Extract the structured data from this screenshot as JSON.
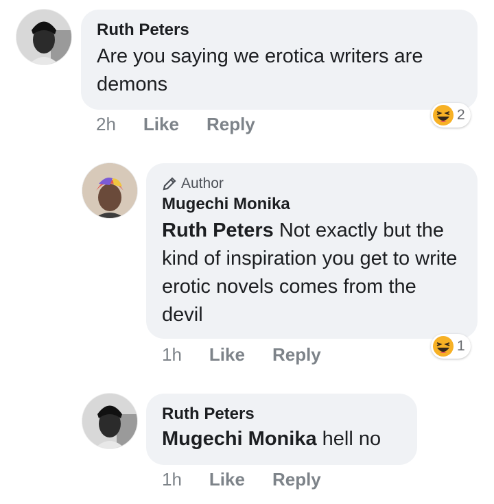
{
  "comments": [
    {
      "name": "Ruth Peters",
      "text": "Are you saying we erotica writers are demons",
      "time": "2h",
      "like_label": "Like",
      "reply_label": "Reply",
      "reaction_icon": "laughing-emoji-icon",
      "reaction_count": "2"
    },
    {
      "badge": "Author",
      "badge_icon": "pencil-icon",
      "name": "Mugechi Monika",
      "mention": "Ruth Peters",
      "text": " Not exactly but the kind of inspiration you get to write erotic novels comes from the devil",
      "time": "1h",
      "like_label": "Like",
      "reply_label": "Reply",
      "reaction_icon": "laughing-emoji-icon",
      "reaction_count": "1"
    },
    {
      "name": "Ruth Peters",
      "mention": "Mugechi Monika",
      "text": " hell no",
      "time": "1h",
      "like_label": "Like",
      "reply_label": "Reply"
    }
  ],
  "colors": {
    "bubble": "#f0f2f5",
    "action_text": "#7d8389",
    "reaction_yellow": "#f7b125"
  }
}
